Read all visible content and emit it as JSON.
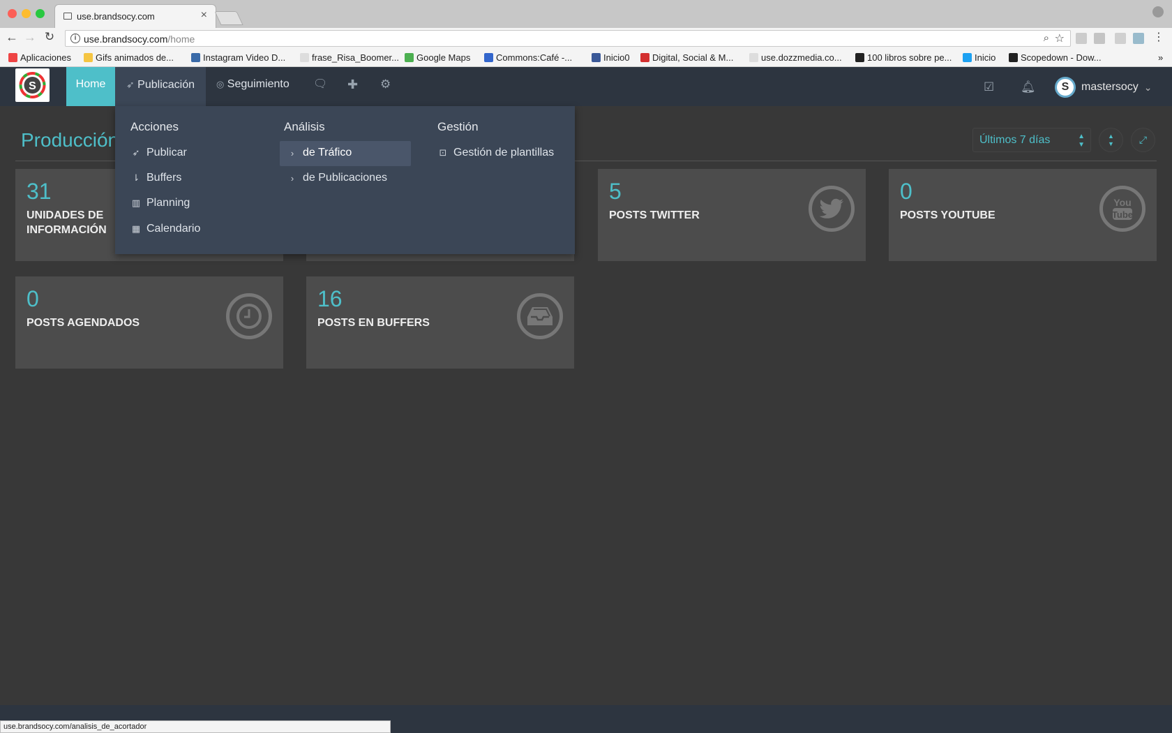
{
  "browser": {
    "tab_title": "use.brandsocy.com",
    "tab_close": "×",
    "url_host": "use.brandsocy.com",
    "url_path": "/home",
    "bookmarks": [
      {
        "label": "Aplicaciones",
        "color": "#e44"
      },
      {
        "label": "Gifs animados de...",
        "color": "#f5c542"
      },
      {
        "label": "Instagram Video D...",
        "color": "#3a6aa8"
      },
      {
        "label": "frase_Risa_Boomer...",
        "color": "#ddd"
      },
      {
        "label": "Google Maps",
        "color": "#4caf50"
      },
      {
        "label": "Commons:Café -...",
        "color": "#3366cc"
      },
      {
        "label": "Inicio0",
        "color": "#3b5998"
      },
      {
        "label": "Digital, Social & M...",
        "color": "#d32f2f"
      },
      {
        "label": "use.dozzmedia.co...",
        "color": "#ddd"
      },
      {
        "label": "100 libros sobre pe...",
        "color": "#222"
      },
      {
        "label": "Inicio",
        "color": "#1da1f2"
      },
      {
        "label": "Scopedown - Dow...",
        "color": "#222"
      }
    ],
    "bookmarks_more": "»",
    "status_url": "use.brandsocy.com/analisis_de_acortador"
  },
  "nav": {
    "home": "Home",
    "publicacion": "Publicación",
    "seguimiento": "Seguimiento",
    "username": "mastersocy",
    "caret": "⌄"
  },
  "dropdown": {
    "acciones_title": "Acciones",
    "acciones": [
      {
        "label": "Publicar",
        "icon": "rocket-icon"
      },
      {
        "label": "Buffers",
        "icon": "sort-icon"
      },
      {
        "label": "Planning",
        "icon": "map-icon"
      },
      {
        "label": "Calendario",
        "icon": "calendar-icon"
      }
    ],
    "analisis_title": "Análisis",
    "analisis": [
      {
        "label": "de Tráfico",
        "icon": "chevron-right-icon"
      },
      {
        "label": "de Publicaciones",
        "icon": "chevron-right-icon"
      }
    ],
    "gestion_title": "Gestión",
    "gestion": [
      {
        "label": "Gestión de plantillas",
        "icon": "template-icon"
      }
    ]
  },
  "page": {
    "title": "Producción",
    "range_select": "Últimos 7 días"
  },
  "cards": [
    {
      "value": "31",
      "label": "UNIDADES DE INFORMACIÓN",
      "icon": "info-icon"
    },
    {
      "value": "5",
      "label": "POSTS TWITTER",
      "icon": "twitter-icon"
    },
    {
      "value": "0",
      "label": "POSTS YOUTUBE",
      "icon": "youtube-icon"
    },
    {
      "value": "0",
      "label": "POSTS AGENDADOS",
      "icon": "clock-icon"
    },
    {
      "value": "16",
      "label": "POSTS EN BUFFERS",
      "icon": "inbox-icon"
    }
  ],
  "colors": {
    "accent": "#4ebfc9",
    "nav_bg": "#2d3540",
    "dropdown_bg": "#3b4656",
    "card_bg": "#4c4c4c",
    "page_bg": "#383838"
  }
}
